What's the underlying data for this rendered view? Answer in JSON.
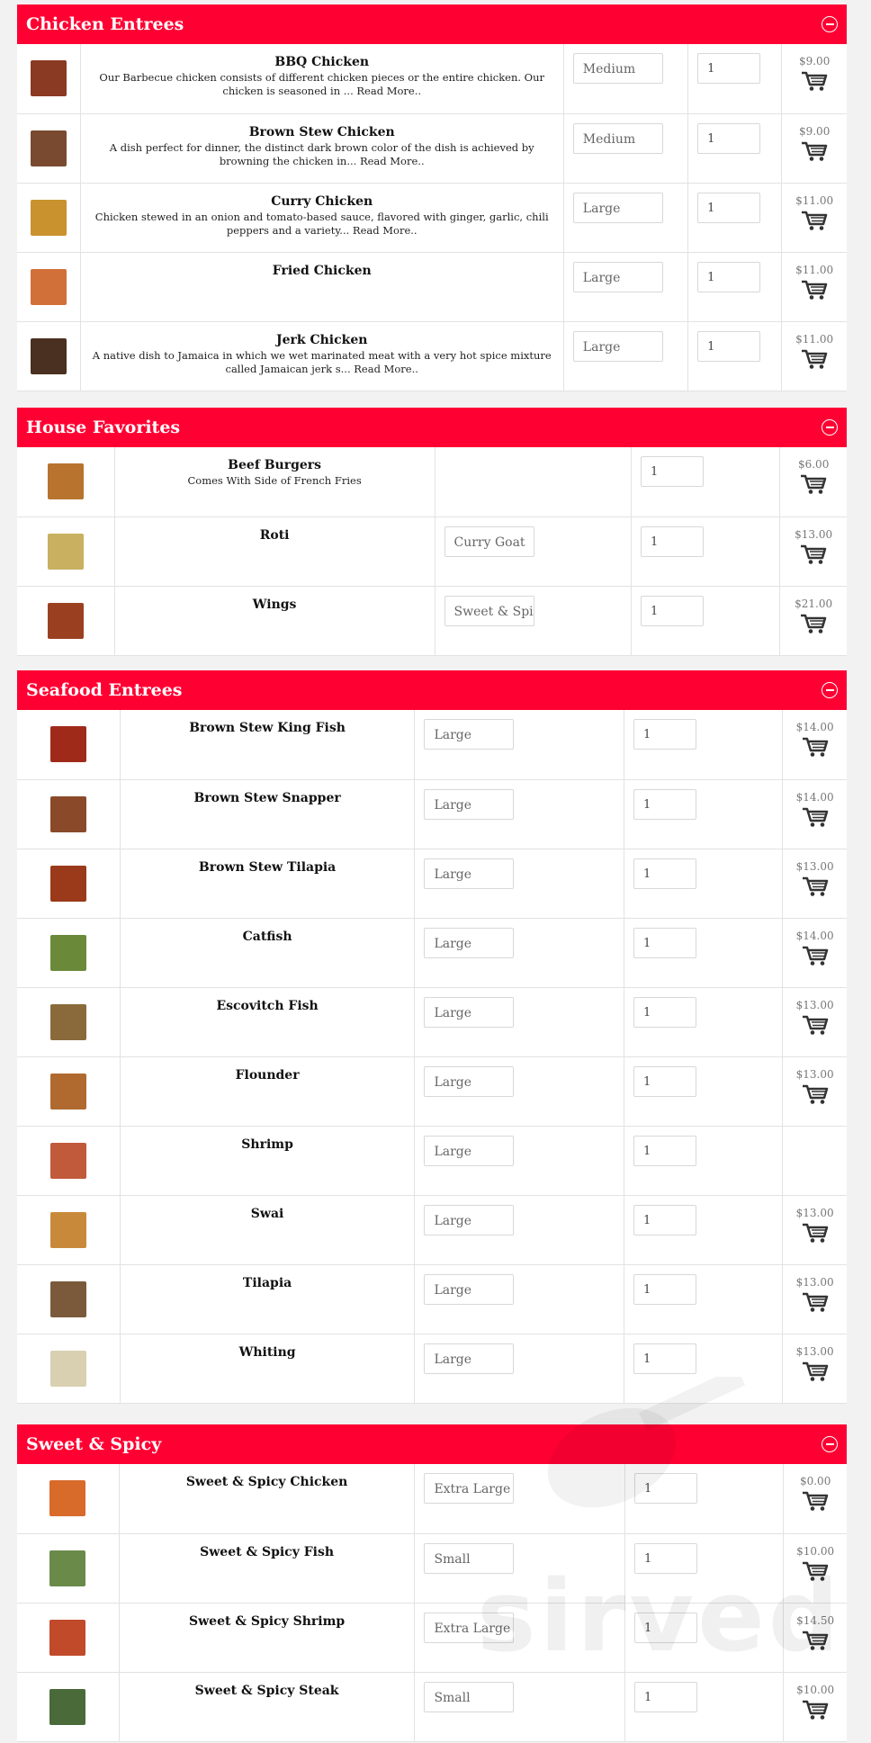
{
  "colors": {
    "header_bg": "#ff0033",
    "header_text": "#ffffff"
  },
  "watermark": "sirved",
  "sections": [
    {
      "title": "Chicken Entrees",
      "items": [
        {
          "name": "BBQ Chicken",
          "desc": "Our Barbecue chicken consists of different chicken pieces or the entire chicken. Our chicken is seasoned in ... Read More..",
          "option": "Medium",
          "qty": "1",
          "price": "$9.00",
          "thumb": "#8a3a22"
        },
        {
          "name": "Brown Stew Chicken",
          "desc": "A dish perfect for dinner, the distinct dark brown color of the dish is achieved by browning the chicken in... Read More..",
          "option": "Medium",
          "qty": "1",
          "price": "$9.00",
          "thumb": "#7a4a30"
        },
        {
          "name": "Curry Chicken",
          "desc": "Chicken stewed in an onion and tomato-based sauce, flavored with ginger, garlic, chili peppers and a variety... Read More..",
          "option": "Large",
          "qty": "1",
          "price": "$11.00",
          "thumb": "#c9922e"
        },
        {
          "name": "Fried Chicken",
          "desc": "",
          "option": "Large",
          "qty": "1",
          "price": "$11.00",
          "thumb": "#d2703a"
        },
        {
          "name": "Jerk Chicken",
          "desc": "A native dish to Jamaica in which we wet marinated meat with a very hot spice mixture called Jamaican jerk s... Read More..",
          "option": "Large",
          "qty": "1",
          "price": "$11.00",
          "thumb": "#4a3020"
        }
      ]
    },
    {
      "title": "House Favorites",
      "items": [
        {
          "name": "Beef Burgers",
          "desc": "Comes With Side of French Fries",
          "option": "",
          "qty": "1",
          "price": "$6.00",
          "thumb": "#b8742e"
        },
        {
          "name": "Roti",
          "desc": "",
          "option": "Curry Goat",
          "qty": "1",
          "price": "$13.00",
          "thumb": "#c8b060"
        },
        {
          "name": "Wings",
          "desc": "",
          "option": "Sweet & Spic",
          "qty": "1",
          "price": "$21.00",
          "thumb": "#9a4020"
        }
      ]
    },
    {
      "title": "Seafood Entrees",
      "items": [
        {
          "name": "Brown Stew King Fish",
          "desc": "",
          "option": "Large",
          "qty": "1",
          "price": "$14.00",
          "thumb": "#a02a1a"
        },
        {
          "name": "Brown Stew Snapper",
          "desc": "",
          "option": "Large",
          "qty": "1",
          "price": "$14.00",
          "thumb": "#8a4a2a"
        },
        {
          "name": "Brown Stew Tilapia",
          "desc": "",
          "option": "Large",
          "qty": "1",
          "price": "$13.00",
          "thumb": "#9a3a1a"
        },
        {
          "name": "Catfish",
          "desc": "",
          "option": "Large",
          "qty": "1",
          "price": "$14.00",
          "thumb": "#6a8a3a"
        },
        {
          "name": "Escovitch Fish",
          "desc": "",
          "option": "Large",
          "qty": "1",
          "price": "$13.00",
          "thumb": "#8a6a3a"
        },
        {
          "name": "Flounder",
          "desc": "",
          "option": "Large",
          "qty": "1",
          "price": "$13.00",
          "thumb": "#b06a30"
        },
        {
          "name": "Shrimp",
          "desc": "",
          "option": "Large",
          "qty": "1",
          "price": "",
          "thumb": "#c05a3a"
        },
        {
          "name": "Swai",
          "desc": "",
          "option": "Large",
          "qty": "1",
          "price": "$13.00",
          "thumb": "#c88a3a"
        },
        {
          "name": "Tilapia",
          "desc": "",
          "option": "Large",
          "qty": "1",
          "price": "$13.00",
          "thumb": "#7a5a3a"
        },
        {
          "name": "Whiting",
          "desc": "",
          "option": "Large",
          "qty": "1",
          "price": "$13.00",
          "thumb": "#d8d0b0"
        }
      ]
    },
    {
      "title": "Sweet & Spicy",
      "items": [
        {
          "name": "Sweet & Spicy Chicken",
          "desc": "",
          "option": "Extra Large",
          "qty": "1",
          "price": "$0.00",
          "thumb": "#d86a2a"
        },
        {
          "name": "Sweet & Spicy Fish",
          "desc": "",
          "option": "Small",
          "qty": "1",
          "price": "$10.00",
          "thumb": "#6a8a4a"
        },
        {
          "name": "Sweet & Spicy Shrimp",
          "desc": "",
          "option": "Extra Large",
          "qty": "1",
          "price": "$14.50",
          "thumb": "#c04a2a"
        },
        {
          "name": "Sweet & Spicy Steak",
          "desc": "",
          "option": "Small",
          "qty": "1",
          "price": "$10.00",
          "thumb": "#4a6a3a"
        }
      ]
    }
  ]
}
